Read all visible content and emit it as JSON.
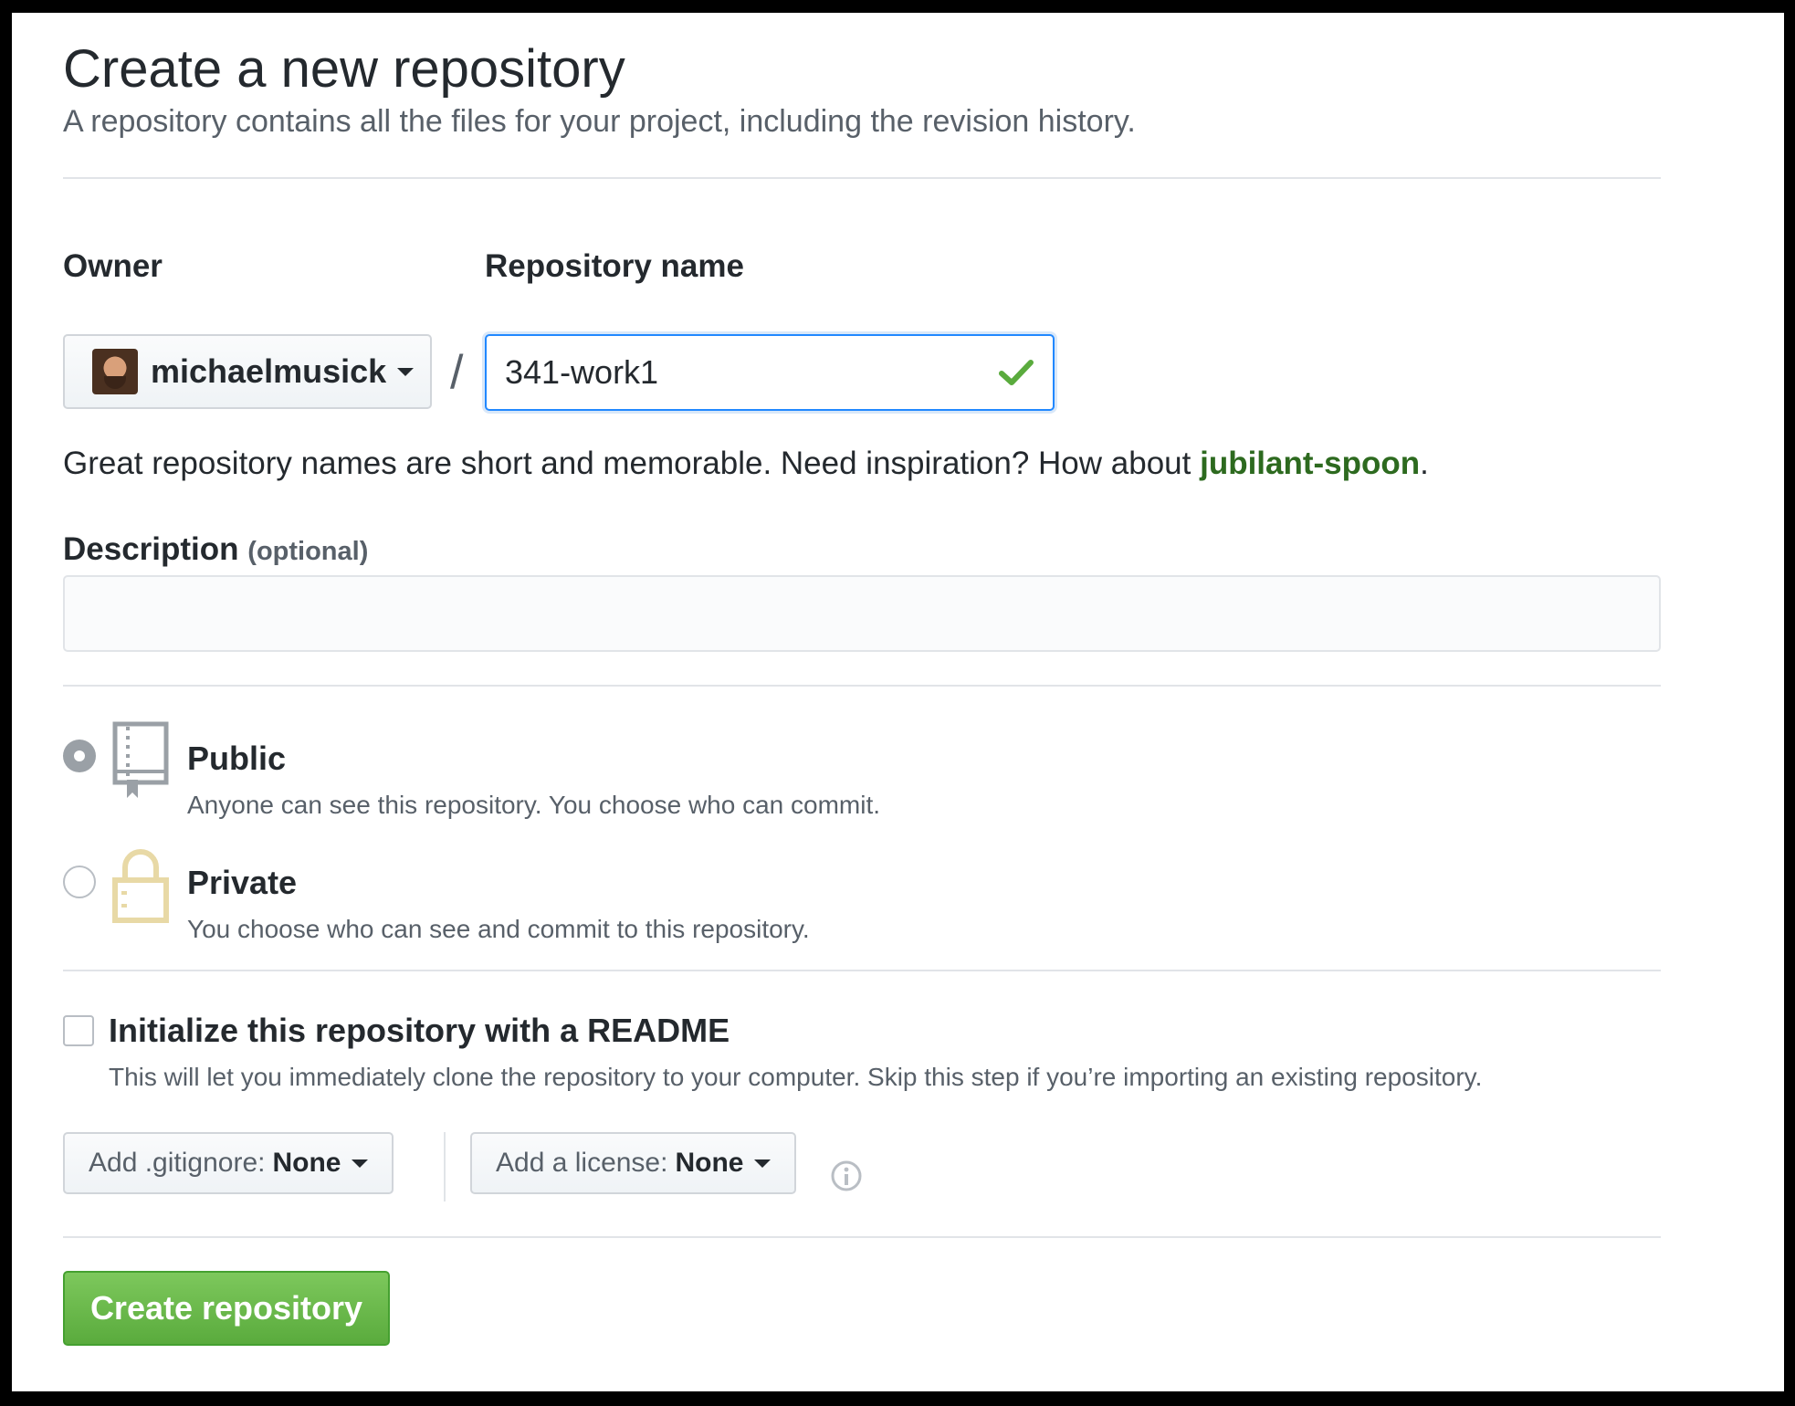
{
  "header": {
    "title": "Create a new repository",
    "subtitle": "A repository contains all the files for your project, including the revision history."
  },
  "owner": {
    "label": "Owner",
    "value": "michaelmusick"
  },
  "separator": "/",
  "repository": {
    "label": "Repository name",
    "value": "341-work1",
    "valid": true
  },
  "hint": {
    "text": "Great repository names are short and memorable. Need inspiration? How about ",
    "suggestion": "jubilant-spoon",
    "end": "."
  },
  "description": {
    "label": "Description",
    "optional": "(optional)",
    "value": ""
  },
  "visibility": {
    "selected": "public",
    "public": {
      "title": "Public",
      "desc": "Anyone can see this repository. You choose who can commit."
    },
    "private": {
      "title": "Private",
      "desc": "You choose who can see and commit to this repository."
    }
  },
  "readme": {
    "checked": false,
    "label": "Initialize this repository with a README",
    "desc": "This will let you immediately clone the repository to your computer. Skip this step if you’re importing an existing repository."
  },
  "gitignore": {
    "prefix": "Add .gitignore:",
    "value": "None"
  },
  "license": {
    "prefix": "Add a license:",
    "value": "None"
  },
  "submit": {
    "label": "Create repository"
  },
  "colors": {
    "accent_green": "#5aab3d",
    "focus_blue": "#2188ff",
    "suggestion_green": "#2d6a1f",
    "private_lock": "#e8d9a6"
  },
  "icons": {
    "public": "repo-book-icon",
    "private": "lock-icon",
    "valid": "check-icon",
    "info": "info-icon"
  }
}
